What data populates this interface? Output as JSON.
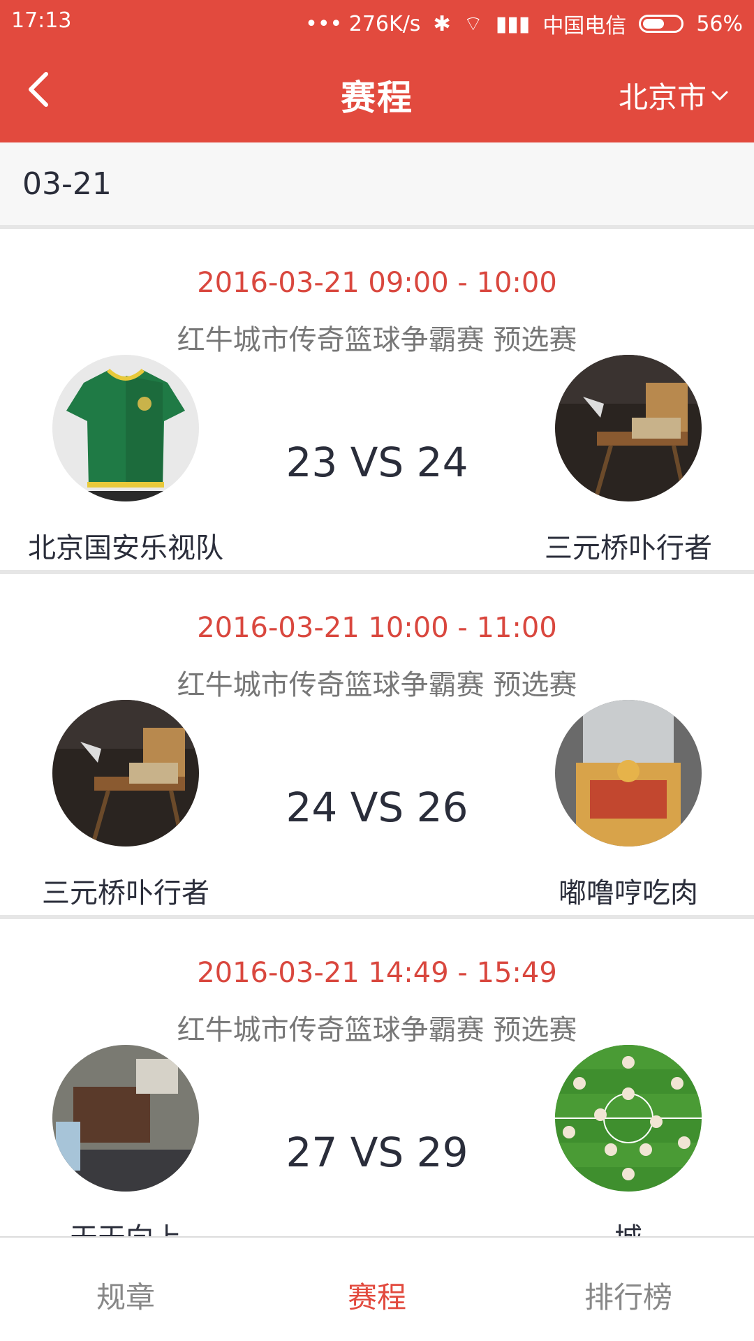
{
  "status_bar": {
    "time": "17:13",
    "network_speed": "••• 276K/s",
    "carrier": "中国电信",
    "battery": "56%"
  },
  "header": {
    "title": "赛程",
    "city": "北京市",
    "back_icon": "chevron-left-icon",
    "city_dropdown_icon": "chevron-down-icon"
  },
  "date": "03-21",
  "matches": [
    {
      "time": "2016-03-21 09:00 - 10:00",
      "event": "红牛城市传奇篮球争霸赛 预选赛",
      "score": "23 VS 24",
      "home": {
        "name": "北京国安乐视队",
        "avatar": "green-jersey"
      },
      "away": {
        "name": "三元桥卟行者",
        "avatar": "chair-photo"
      }
    },
    {
      "time": "2016-03-21 10:00 - 11:00",
      "event": "红牛城市传奇篮球争霸赛 预选赛",
      "score": "24 VS 26",
      "home": {
        "name": "三元桥卟行者",
        "avatar": "chair-photo"
      },
      "away": {
        "name": "嘟噜哼吃肉",
        "avatar": "bottle-photo"
      }
    },
    {
      "time": "2016-03-21 14:49 - 15:49",
      "event": "红牛城市传奇篮球争霸赛 预选赛",
      "score": "27 VS 29",
      "home": {
        "name": "天天向上",
        "avatar": "desk-photo"
      },
      "away": {
        "name": "城",
        "avatar": "football-field"
      }
    }
  ],
  "tabs": [
    {
      "label": "规章",
      "active": false
    },
    {
      "label": "赛程",
      "active": true
    },
    {
      "label": "排行榜",
      "active": false
    }
  ],
  "colors": {
    "accent": "#e24a3e",
    "time_text": "#d9473e",
    "divider": "#e6e6e6"
  }
}
